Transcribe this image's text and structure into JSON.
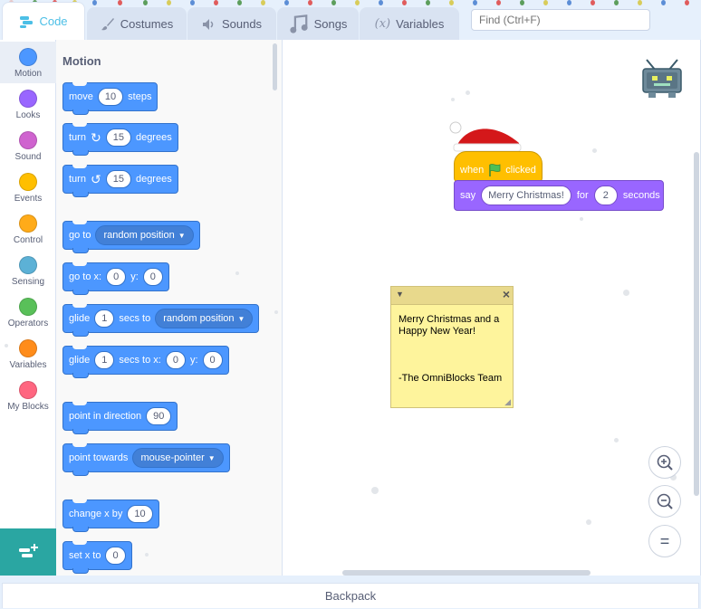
{
  "tabs": [
    {
      "label": "Code",
      "icon": "code-icon",
      "active": true
    },
    {
      "label": "Costumes",
      "icon": "brush-icon",
      "active": false
    },
    {
      "label": "Sounds",
      "icon": "speaker-icon",
      "active": false
    },
    {
      "label": "Songs",
      "icon": "music-note-icon",
      "active": false
    },
    {
      "label": "Variables",
      "icon": "variable-x-icon",
      "active": false
    }
  ],
  "search": {
    "placeholder": "Find (Ctrl+F)"
  },
  "categories": [
    {
      "label": "Motion",
      "color": "#4c97ff"
    },
    {
      "label": "Looks",
      "color": "#9966ff"
    },
    {
      "label": "Sound",
      "color": "#cf63cf"
    },
    {
      "label": "Events",
      "color": "#ffbf00"
    },
    {
      "label": "Control",
      "color": "#ffab19"
    },
    {
      "label": "Sensing",
      "color": "#5cb1d6"
    },
    {
      "label": "Operators",
      "color": "#59c059"
    },
    {
      "label": "Variables",
      "color": "#ff8c1a"
    },
    {
      "label": "My Blocks",
      "color": "#ff6680"
    }
  ],
  "palette": {
    "heading": "Motion",
    "move": {
      "a": "move",
      "n": "10",
      "b": "steps"
    },
    "turn_right": {
      "a": "turn",
      "n": "15",
      "b": "degrees"
    },
    "turn_left": {
      "a": "turn",
      "n": "15",
      "b": "degrees"
    },
    "goto": {
      "a": "go to",
      "menu": "random position"
    },
    "gotoxy": {
      "a": "go to x:",
      "x": "0",
      "b": "y:",
      "y": "0"
    },
    "glide": {
      "a": "glide",
      "n": "1",
      "b": "secs to",
      "menu": "random position"
    },
    "glidexy": {
      "a": "glide",
      "n": "1",
      "b": "secs to x:",
      "x": "0",
      "c": "y:",
      "y": "0"
    },
    "point": {
      "a": "point in direction",
      "n": "90"
    },
    "towards": {
      "a": "point towards",
      "menu": "mouse-pointer"
    },
    "changex": {
      "a": "change x by",
      "n": "10"
    },
    "setx": {
      "a": "set x to",
      "n": "0"
    }
  },
  "script": {
    "hat": {
      "a": "when",
      "b": "clicked"
    },
    "say": {
      "a": "say",
      "text": "Merry Christmas!",
      "b": "for",
      "n": "2",
      "c": "seconds"
    }
  },
  "note": {
    "text": "Merry Christmas and a\nHappy New Year!\n\n\n\n-The OmniBlocks Team"
  },
  "zoom": {
    "in": "+",
    "out": "−",
    "reset": "="
  },
  "backpack": {
    "label": "Backpack"
  },
  "colors": {
    "accent": "#4cbfe6",
    "motion": "#4c97ff",
    "events": "#ffbf00",
    "looks": "#9966ff",
    "extension": "#2aa6a2"
  }
}
